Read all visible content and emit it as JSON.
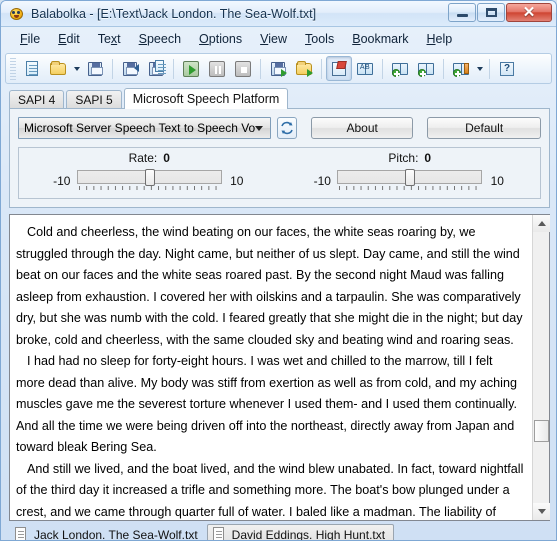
{
  "window": {
    "title": "Balabolka - [E:\\Text\\Jack London. The Sea-Wolf.txt]",
    "app_icon": "balabolka-face-icon",
    "minimize_label": "",
    "maximize_label": "",
    "close_label": "✕"
  },
  "menu": {
    "items": [
      {
        "label": "File",
        "accel": "F"
      },
      {
        "label": "Edit",
        "accel": "E"
      },
      {
        "label": "Text",
        "accel": "x"
      },
      {
        "label": "Speech",
        "accel": "S"
      },
      {
        "label": "Options",
        "accel": "O"
      },
      {
        "label": "View",
        "accel": "V"
      },
      {
        "label": "Tools",
        "accel": "T"
      },
      {
        "label": "Bookmark",
        "accel": "B"
      },
      {
        "label": "Help",
        "accel": "H"
      }
    ]
  },
  "toolbar": {
    "buttons": [
      {
        "name": "new-document-icon"
      },
      {
        "name": "open-folder-icon"
      },
      {
        "name": "open-folder-dropdown-arrow-icon"
      },
      {
        "name": "save-file-icon"
      },
      {
        "name": "save-audio-file-icon"
      },
      {
        "name": "save-audio-split-icon"
      },
      {
        "name": "play-icon"
      },
      {
        "name": "pause-icon"
      },
      {
        "name": "stop-icon"
      },
      {
        "name": "batch-convert-icon"
      },
      {
        "name": "batch-folder-icon"
      },
      {
        "name": "edit-notepad-icon"
      },
      {
        "name": "spell-check-icon"
      },
      {
        "name": "add-bookmark-icon"
      },
      {
        "name": "goto-bookmark-icon"
      },
      {
        "name": "bookmark-manager-icon"
      },
      {
        "name": "bookmark-dropdown-arrow-icon"
      },
      {
        "name": "help-icon"
      }
    ]
  },
  "sapi_tabs": [
    {
      "label": "SAPI 4",
      "active": false
    },
    {
      "label": "SAPI 5",
      "active": false
    },
    {
      "label": "Microsoft Speech Platform",
      "active": true
    }
  ],
  "settings": {
    "voice_selected": "Microsoft Server Speech Text to Speech Voice (e",
    "refresh_icon": "refresh-voices-icon",
    "about_label": "About",
    "default_label": "Default"
  },
  "sliders": [
    {
      "name": "rate",
      "caption": "Rate:",
      "value": "0",
      "min_label": "-10",
      "max_label": "10"
    },
    {
      "name": "pitch",
      "caption": "Pitch:",
      "value": "0",
      "min_label": "-10",
      "max_label": "10"
    }
  ],
  "editor": {
    "paragraphs": [
      "Cold and cheerless, the wind beating on our faces, the white seas roaring by, we struggled through the day. Night came, but neither of us slept. Day came, and still the wind beat on our faces and the white seas roared past. By the second night Maud was falling asleep from exhaustion. I covered her with oilskins and a tarpaulin. She was comparatively dry, but she was numb with the cold. I feared greatly that she might die in the night; but day broke, cold and cheerless, with the same clouded sky and beating wind and roaring seas.",
      "I had had no sleep for forty-eight hours. I was wet and chilled to the marrow, till I felt more dead than alive. My body was stiff from exertion as well as from cold, and my aching muscles gave me the severest torture whenever I used them- and I used them continually. And all the time we were being driven off into the northeast, directly away from Japan and toward bleak Bering Sea.",
      "And still we lived, and the boat lived, and the wind blew unabated. In fact, toward nightfall of the third day it increased a trifle and something more. The boat's bow plunged under a crest, and we came through quarter full of water. I baled like a madman. The liability of shipping another such sea was enormously increased by the"
    ],
    "scroll_up_icon": "scroll-up-arrow-icon",
    "scroll_down_icon": "scroll-down-arrow-icon"
  },
  "document_tabs": [
    {
      "label": "Jack London. The Sea-Wolf.txt",
      "selected": false,
      "icon": "document-icon"
    },
    {
      "label": "David Eddings. High Hunt.txt",
      "selected": true,
      "icon": "document-icon"
    }
  ]
}
